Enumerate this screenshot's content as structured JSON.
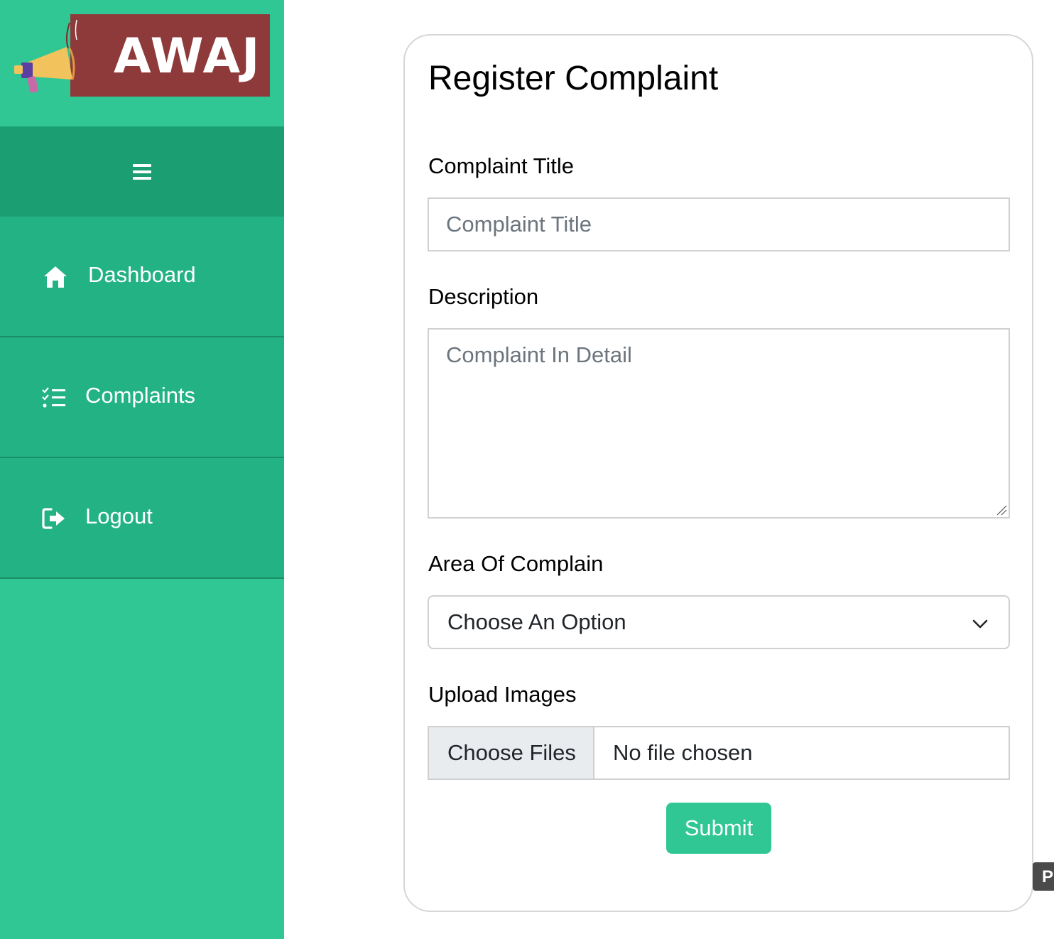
{
  "brand": {
    "name": "AWAJ",
    "banner_color": "#8f3a3a",
    "logo_icon": "megaphone-icon"
  },
  "sidebar": {
    "background": "#31c795",
    "toggle_icon": "hamburger-menu-icon",
    "items": [
      {
        "label": "Dashboard",
        "icon": "home-icon"
      },
      {
        "label": "Complaints",
        "icon": "checklist-icon"
      },
      {
        "label": "Logout",
        "icon": "logout-icon"
      }
    ]
  },
  "form": {
    "title": "Register Complaint",
    "fields": {
      "title": {
        "label": "Complaint Title",
        "placeholder": "Complaint Title",
        "value": ""
      },
      "description": {
        "label": "Description",
        "placeholder": "Complaint In Detail",
        "value": ""
      },
      "area": {
        "label": "Area Of Complain",
        "selected": "Choose An Option"
      },
      "images": {
        "label": "Upload Images",
        "button_label": "Choose Files",
        "status": "No file chosen"
      }
    },
    "submit_label": "Submit",
    "accent_color": "#31c795"
  },
  "edge_tab": {
    "label": "P"
  }
}
